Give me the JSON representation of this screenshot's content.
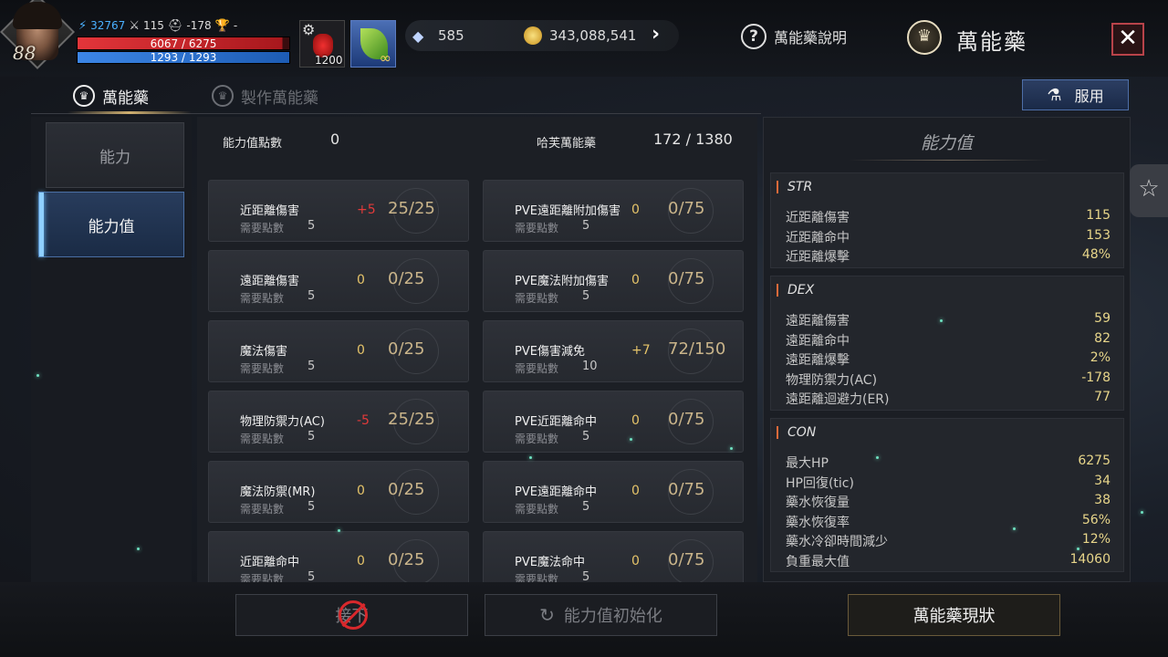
{
  "player": {
    "level": "88",
    "power": "32767",
    "attack": "115",
    "defense": "-178",
    "trophy": "-",
    "hp_text": "6067 / 6275",
    "hp_fraction": 0.967,
    "mp_text": "1293 / 1293",
    "mp_fraction": 1.0
  },
  "quickslots": {
    "potion_count": "1200",
    "buff_count": "∞"
  },
  "currency": {
    "gems": "585",
    "gold": "343,088,541"
  },
  "header": {
    "help_label": "萬能藥說明",
    "title": "萬能藥"
  },
  "tabs": [
    {
      "label": "萬能藥"
    },
    {
      "label": "製作萬能藥"
    }
  ],
  "use_button_label": "服用",
  "left_menu": [
    {
      "label": "能力"
    },
    {
      "label": "能力值"
    }
  ],
  "summary": {
    "points_label": "能力值點數",
    "points_value": "0",
    "haf_label": "哈芙萬能藥",
    "haf_value": "172 / 1380"
  },
  "required_label": "需要點數",
  "cards_left": [
    {
      "name": "近距離傷害",
      "bonus": "+5",
      "progress": "25/25",
      "req": "5"
    },
    {
      "name": "遠距離傷害",
      "bonus": "0",
      "progress": "0/25",
      "req": "5"
    },
    {
      "name": "魔法傷害",
      "bonus": "0",
      "progress": "0/25",
      "req": "5"
    },
    {
      "name": "物理防禦力(AC)",
      "bonus": "-5",
      "progress": "25/25",
      "req": "5"
    },
    {
      "name": "魔法防禦(MR)",
      "bonus": "0",
      "progress": "0/25",
      "req": "5"
    },
    {
      "name": "近距離命中",
      "bonus": "0",
      "progress": "0/25",
      "req": "5"
    }
  ],
  "cards_right": [
    {
      "name": "PVE遠距離附加傷害",
      "bonus": "0",
      "progress": "0/75",
      "req": "5"
    },
    {
      "name": "PVE魔法附加傷害",
      "bonus": "0",
      "progress": "0/75",
      "req": "5"
    },
    {
      "name": "PVE傷害減免",
      "bonus": "+7",
      "progress": "72/150",
      "req": "10"
    },
    {
      "name": "PVE近距離命中",
      "bonus": "0",
      "progress": "0/75",
      "req": "5"
    },
    {
      "name": "PVE遠距離命中",
      "bonus": "0",
      "progress": "0/75",
      "req": "5"
    },
    {
      "name": "PVE魔法命中",
      "bonus": "0",
      "progress": "0/75",
      "req": "5"
    }
  ],
  "stats_panel": {
    "title": "能力值",
    "sections": [
      {
        "header": "STR",
        "rows": [
          {
            "label": "近距離傷害",
            "value": "115"
          },
          {
            "label": "近距離命中",
            "value": "153"
          },
          {
            "label": "近距離爆擊",
            "value": "48%"
          }
        ]
      },
      {
        "header": "DEX",
        "rows": [
          {
            "label": "遠距離傷害",
            "value": "59"
          },
          {
            "label": "遠距離命中",
            "value": "82"
          },
          {
            "label": "遠距離爆擊",
            "value": "2%"
          },
          {
            "label": "物理防禦力(AC)",
            "value": "-178"
          },
          {
            "label": "遠距離迴避力(ER)",
            "value": "77"
          }
        ]
      },
      {
        "header": "CON",
        "rows": [
          {
            "label": "最大HP",
            "value": "6275"
          },
          {
            "label": "HP回復(tic)",
            "value": "34"
          },
          {
            "label": "藥水恢復量",
            "value": "38"
          },
          {
            "label": "藥水恢復率",
            "value": "56%"
          },
          {
            "label": "藥水冷卻時間減少",
            "value": "12%"
          },
          {
            "label": "負重最大值",
            "value": "14060"
          }
        ]
      }
    ]
  },
  "bottom": {
    "next_label": "接下",
    "reset_label": "能力值初始化",
    "status_label": "萬能藥現狀"
  },
  "colors": {
    "positive": "#e23a3a",
    "neutral": "#e6c46a",
    "value": "#e8d68a",
    "accent_blue": "#4a6fa4",
    "gold_border": "#6a5a3a"
  }
}
